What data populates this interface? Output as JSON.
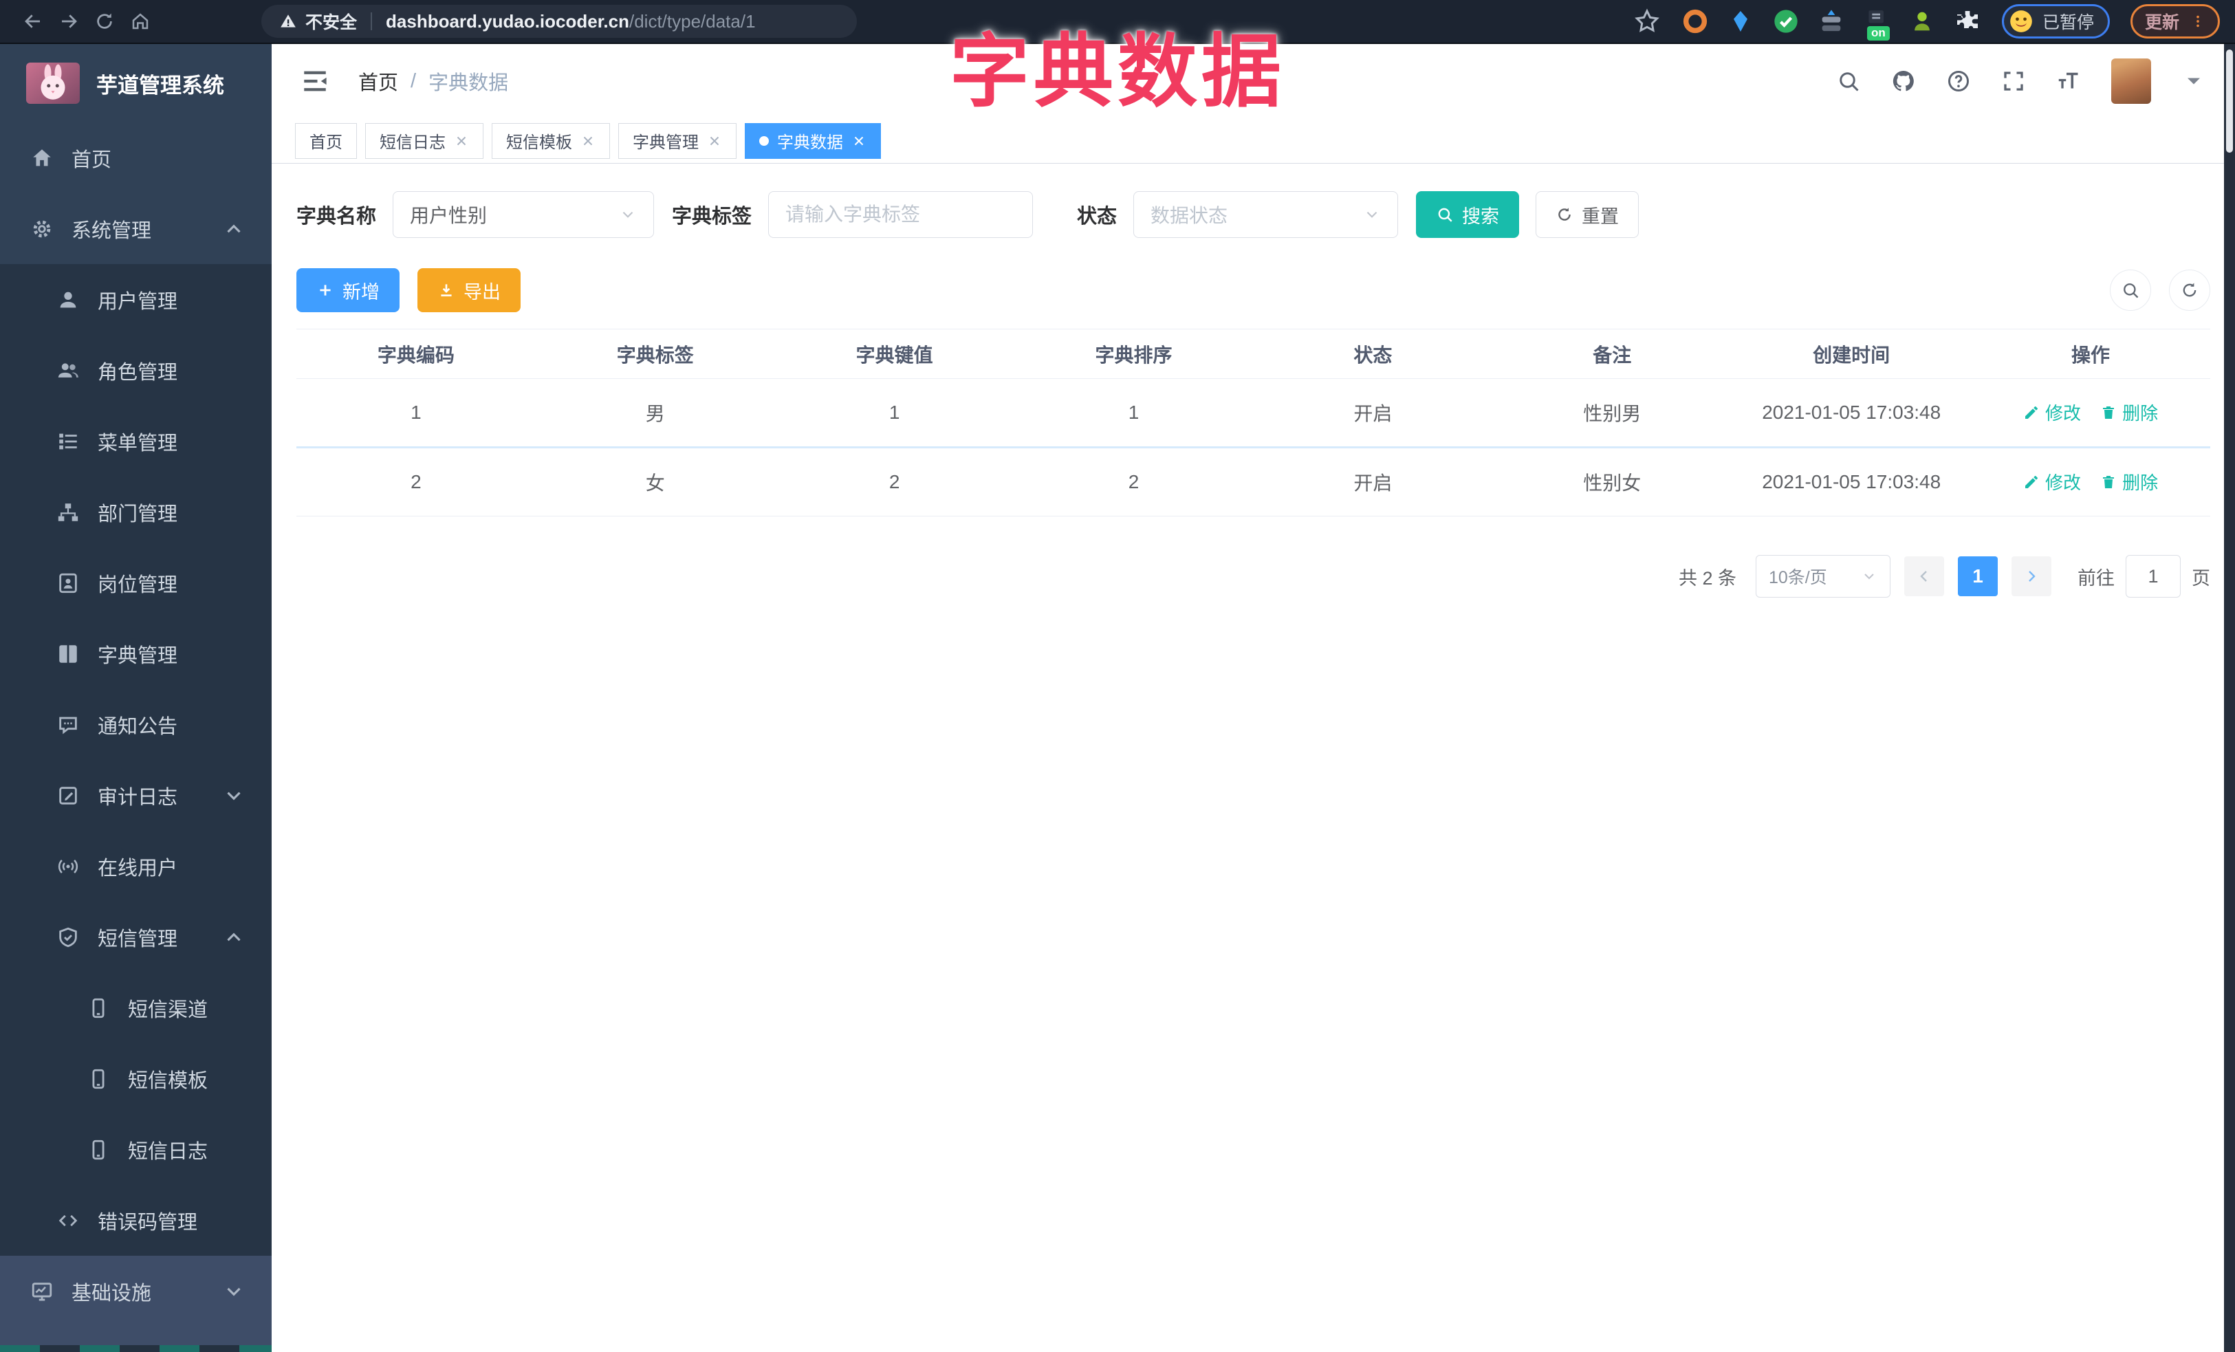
{
  "browser": {
    "security_label": "不安全",
    "url_host": "dashboard.yudao.iocoder.cn",
    "url_path": "/dict/type/data/1",
    "profile_status": "已暂停",
    "update_label": "更新",
    "extensions": [
      {
        "icon": "ext-ring"
      },
      {
        "icon": "ext-gem"
      },
      {
        "icon": "ext-check"
      },
      {
        "icon": "ext-toggle"
      },
      {
        "icon": "ext-on",
        "badge": "on"
      },
      {
        "icon": "ext-user"
      },
      {
        "icon": "ext-puzzle"
      }
    ]
  },
  "overlay_title": "字典数据",
  "colors": {
    "primary": "#409eff",
    "theme_teal": "#18bcab",
    "warning": "#f6a723",
    "overlay_rose": "#f13b5f"
  },
  "sidebar": {
    "logo_title": "芋道管理系统",
    "items": [
      {
        "label": "首页",
        "icon": "home",
        "level": 1
      },
      {
        "label": "系统管理",
        "icon": "gear",
        "level": 1,
        "chevron": "up"
      },
      {
        "label": "用户管理",
        "icon": "user",
        "level": 2
      },
      {
        "label": "角色管理",
        "icon": "users",
        "level": 2
      },
      {
        "label": "菜单管理",
        "icon": "menu-list",
        "level": 2
      },
      {
        "label": "部门管理",
        "icon": "org-tree",
        "level": 2
      },
      {
        "label": "岗位管理",
        "icon": "id-badge",
        "level": 2
      },
      {
        "label": "字典管理",
        "icon": "book",
        "level": 2
      },
      {
        "label": "通知公告",
        "icon": "message-bubble",
        "level": 2
      },
      {
        "label": "审计日志",
        "icon": "log-edit",
        "level": 2,
        "chevron": "down"
      },
      {
        "label": "在线用户",
        "icon": "online-signal",
        "level": 2
      },
      {
        "label": "短信管理",
        "icon": "shield-check",
        "level": 2,
        "chevron": "up"
      },
      {
        "label": "短信渠道",
        "icon": "phone",
        "level": 3
      },
      {
        "label": "短信模板",
        "icon": "phone",
        "level": 3
      },
      {
        "label": "短信日志",
        "icon": "phone",
        "level": 3
      },
      {
        "label": "错误码管理",
        "icon": "code",
        "level": 2
      },
      {
        "label": "基础设施",
        "icon": "monitor-chart",
        "level": 1,
        "chevron": "down",
        "highlight": true
      }
    ]
  },
  "header": {
    "breadcrumb_home": "首页",
    "breadcrumb_separator": "/",
    "breadcrumb_current": "字典数据"
  },
  "tabs": [
    {
      "label": "首页",
      "closable": false,
      "active": false
    },
    {
      "label": "短信日志",
      "closable": true,
      "active": false
    },
    {
      "label": "短信模板",
      "closable": true,
      "active": false
    },
    {
      "label": "字典管理",
      "closable": true,
      "active": false
    },
    {
      "label": "字典数据",
      "closable": true,
      "active": true
    }
  ],
  "filters": {
    "dict_name_label": "字典名称",
    "dict_name_value": "用户性别",
    "dict_label_label": "字典标签",
    "dict_label_placeholder": "请输入字典标签",
    "status_label": "状态",
    "status_placeholder": "数据状态",
    "search_label": "搜索",
    "reset_label": "重置"
  },
  "toolbar": {
    "add_label": "新增",
    "export_label": "导出"
  },
  "table": {
    "headers": [
      "字典编码",
      "字典标签",
      "字典键值",
      "字典排序",
      "状态",
      "备注",
      "创建时间",
      "操作"
    ],
    "rows": [
      {
        "code": "1",
        "label": "男",
        "value": "1",
        "sort": "1",
        "status": "开启",
        "remark": "性别男",
        "created": "2021-01-05 17:03:48"
      },
      {
        "code": "2",
        "label": "女",
        "value": "2",
        "sort": "2",
        "status": "开启",
        "remark": "性别女",
        "created": "2021-01-05 17:03:48"
      }
    ],
    "edit_label": "修改",
    "delete_label": "删除"
  },
  "pagination": {
    "total": "共 2 条",
    "page_size": "10条/页",
    "current_page": "1",
    "goto_label": "前往",
    "goto_value": "1",
    "page_unit": "页"
  }
}
